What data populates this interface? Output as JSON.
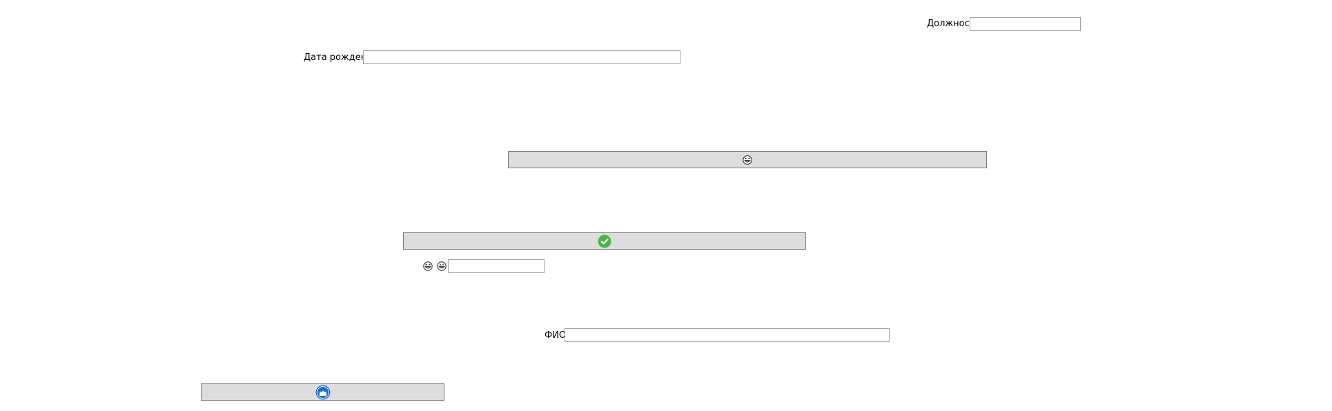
{
  "form": {
    "position_label": "Должность",
    "position_value": "",
    "birthdate_label": "Дата рождения",
    "birthdate_value": "",
    "fullname_label": "ФИО",
    "fullname_value": "",
    "emoji_field_value": ""
  },
  "buttons": {
    "emoji_button_icon": "grinning-squinting-face-icon",
    "confirm_button_icon": "green-checkmark-circle-icon",
    "confirm_button_color": "#4cb648",
    "blue_button_icon": "blue-badge-icon",
    "blue_button_color": "#1f6fc4"
  },
  "emoji_row": {
    "first_icon": "grinning-squinting-face-icon",
    "second_icon": "grinning-face-icon"
  }
}
